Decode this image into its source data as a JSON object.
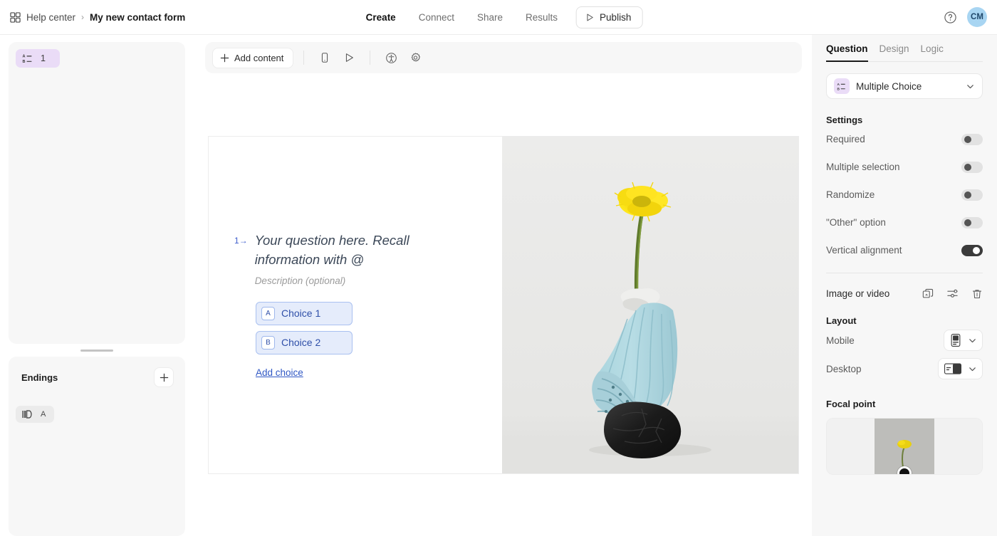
{
  "topbar": {
    "breadcrumb": {
      "grid_icon": "grid-icon",
      "help_center": "Help center",
      "separator": "›",
      "form_title": "My new contact form"
    },
    "nav": [
      {
        "label": "Create",
        "active": true
      },
      {
        "label": "Connect",
        "active": false
      },
      {
        "label": "Share",
        "active": false
      },
      {
        "label": "Results",
        "active": false
      }
    ],
    "publish": {
      "label": "Publish",
      "icon": "play-publish-icon"
    },
    "help_icon": "help-circle-icon",
    "avatar_initials": "CM"
  },
  "sidebar": {
    "questions": [
      {
        "icon": "multiple-choice-icon",
        "number": "1"
      }
    ],
    "endings": {
      "title": "Endings",
      "add_label": "+",
      "items": [
        {
          "icon": "ending-flag-icon",
          "letter": "A"
        }
      ]
    }
  },
  "toolbar": {
    "add_content": "Add content",
    "icons": [
      "mobile-preview-icon",
      "play-preview-icon",
      "accessibility-icon",
      "settings-gear-icon"
    ]
  },
  "canvas": {
    "question_number": "1",
    "question_arrow": "→",
    "question_text": "Your question here. Recall information with @",
    "description": "Description (optional)",
    "choices": [
      {
        "key": "A",
        "label": "Choice 1"
      },
      {
        "key": "B",
        "label": "Choice 2"
      }
    ],
    "add_choice": "Add choice",
    "image_alt": "yellow-flower-sculpture-image"
  },
  "right_panel": {
    "tabs": [
      {
        "label": "Question",
        "active": true
      },
      {
        "label": "Design",
        "active": false
      },
      {
        "label": "Logic",
        "active": false
      }
    ],
    "question_type": {
      "label": "Multiple Choice",
      "icon": "multiple-choice-icon",
      "chevron": "chevron-down-icon"
    },
    "settings_title": "Settings",
    "settings": [
      {
        "label": "Required",
        "on": false
      },
      {
        "label": "Multiple selection",
        "on": false
      },
      {
        "label": "Randomize",
        "on": false
      },
      {
        "label": "\"Other\" option",
        "on": false
      },
      {
        "label": "Vertical alignment",
        "on": true
      }
    ],
    "media": {
      "label": "Image or video",
      "icons": [
        "replace-media-icon",
        "adjust-sliders-icon",
        "trash-icon"
      ]
    },
    "layout_title": "Layout",
    "layout": [
      {
        "label": "Mobile",
        "preview": "layout-stacked-icon"
      },
      {
        "label": "Desktop",
        "preview": "layout-split-right-icon"
      }
    ],
    "focal_title": "Focal point"
  },
  "colors": {
    "accent_purple": "#eadcf7",
    "choice_blue_bg": "#e5ecfb",
    "choice_blue_border": "#a9c0f0",
    "choice_blue_text": "#2f4fa8",
    "avatar_bg": "#a8d5f2",
    "panel_bg": "#f7f7f7",
    "toggle_on": "#3b3b3b"
  }
}
